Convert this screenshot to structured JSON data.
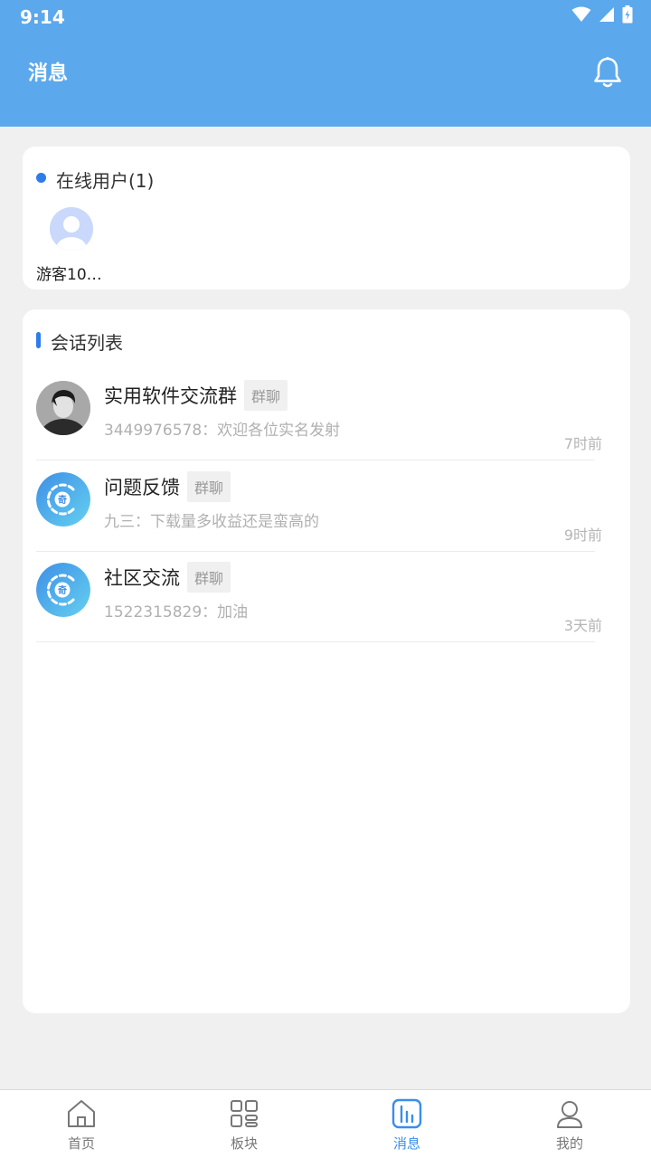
{
  "status_bar": {
    "time": "9:14"
  },
  "header": {
    "title": "消息"
  },
  "online": {
    "title": "在线用户(1)",
    "users": [
      {
        "name": "游客10…"
      }
    ]
  },
  "sessions": {
    "title": "会话列表",
    "items": [
      {
        "name": "实用软件交流群",
        "tag": "群聊",
        "preview": "3449976578：欢迎各位实名发射",
        "time": "7时前"
      },
      {
        "name": "问题反馈",
        "tag": "群聊",
        "preview": "九三：下载量多收益还是蛮高的",
        "time": "9时前"
      },
      {
        "name": "社区交流",
        "tag": "群聊",
        "preview": "1522315829：加油",
        "time": "3天前"
      }
    ]
  },
  "nav": {
    "items": [
      {
        "label": "首页",
        "icon": "home-icon"
      },
      {
        "label": "板块",
        "icon": "grid-icon"
      },
      {
        "label": "消息",
        "icon": "message-icon"
      },
      {
        "label": "我的",
        "icon": "user-icon"
      }
    ],
    "active": 2
  },
  "colors": {
    "header": "#5ba8ec",
    "accent": "#2e7bea",
    "nav_active": "#3a8ee8"
  }
}
